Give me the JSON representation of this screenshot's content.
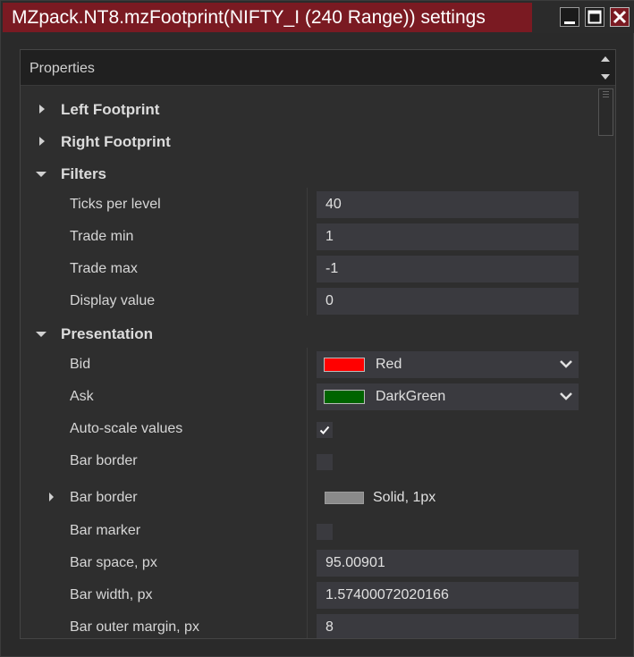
{
  "window": {
    "title": "MZpack.NT8.mzFootprint(NIFTY_I (240 Range)) settings",
    "accent_color": "#7a1a22"
  },
  "titlebar_icons": [
    "minimize-icon",
    "maximize-icon",
    "close-icon"
  ],
  "panel": {
    "header": "Properties"
  },
  "categories": {
    "left_footprint": "Left Footprint",
    "right_footprint": "Right Footprint",
    "filters": "Filters",
    "presentation": "Presentation"
  },
  "filters": {
    "ticks_per_level": {
      "label": "Ticks per level",
      "value": "40"
    },
    "trade_min": {
      "label": "Trade min",
      "value": "1"
    },
    "trade_max": {
      "label": "Trade max",
      "value": "-1"
    },
    "display_value": {
      "label": "Display value",
      "value": "0"
    }
  },
  "presentation": {
    "bid": {
      "label": "Bid",
      "value": "Red",
      "swatch": "#ff0000"
    },
    "ask": {
      "label": "Ask",
      "value": "DarkGreen",
      "swatch": "#006400"
    },
    "auto_scale": {
      "label": "Auto-scale values",
      "checked": true
    },
    "bar_border_toggle": {
      "label": "Bar border",
      "checked": false
    },
    "bar_border_style": {
      "label": "Bar border",
      "value": "Solid, 1px",
      "swatch": "#8a8a8a"
    },
    "bar_marker": {
      "label": "Bar marker",
      "checked": false
    },
    "bar_space": {
      "label": "Bar space, px",
      "value": "95.00901"
    },
    "bar_width": {
      "label": "Bar width, px",
      "value": "1.57400072020166"
    },
    "bar_outer_margin": {
      "label": "Bar outer margin, px",
      "value": "8"
    }
  }
}
